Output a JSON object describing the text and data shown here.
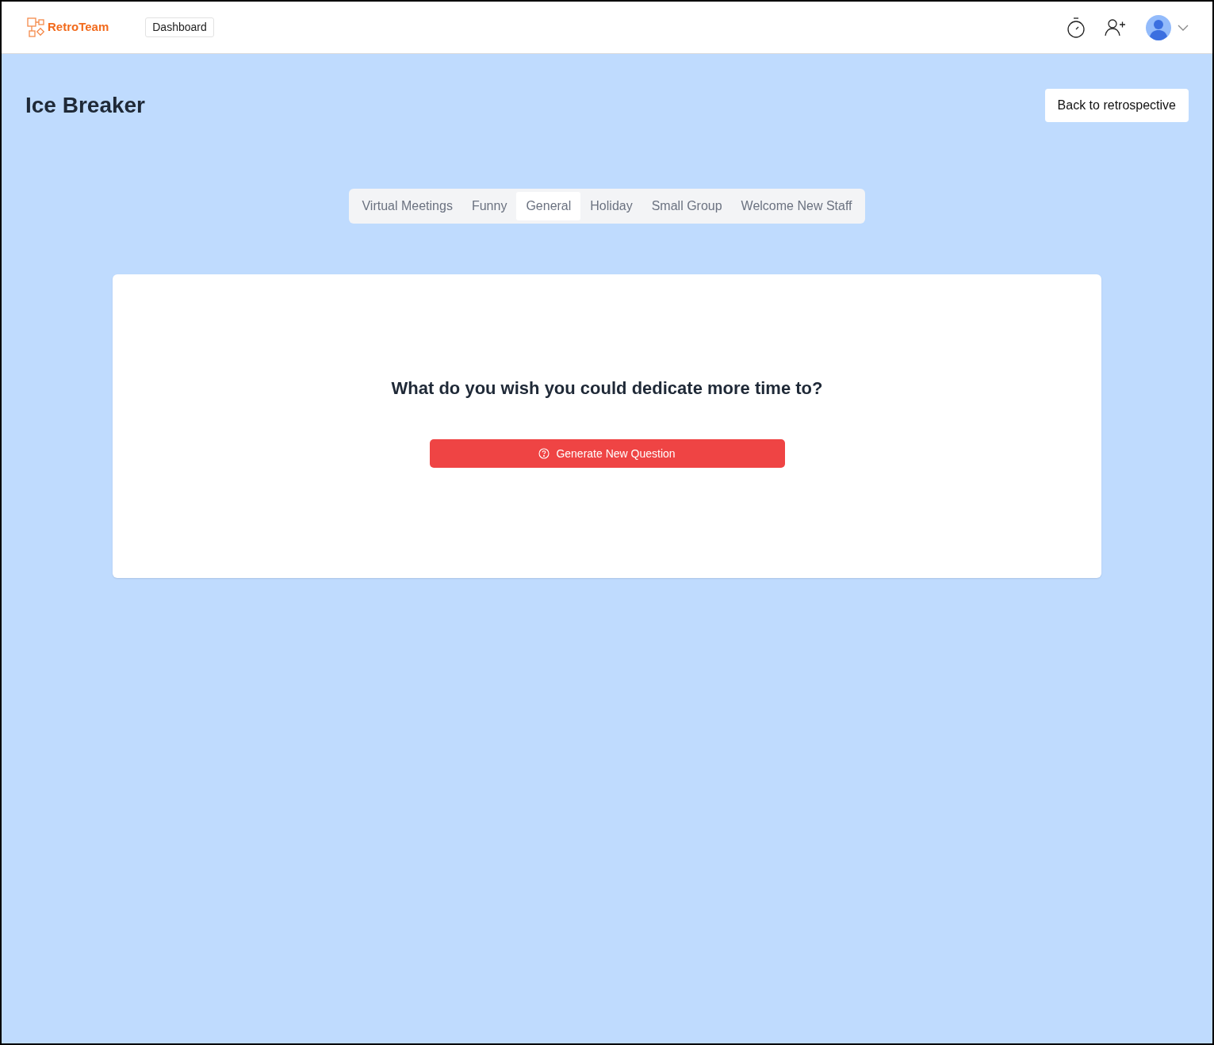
{
  "header": {
    "logo": "RetroTeam",
    "nav_link": "Dashboard"
  },
  "page": {
    "title": "Ice Breaker",
    "back_button": "Back to retrospective"
  },
  "tabs": [
    {
      "label": "Virtual Meetings",
      "selected": false
    },
    {
      "label": "Funny",
      "selected": false
    },
    {
      "label": "General",
      "selected": true
    },
    {
      "label": "Holiday",
      "selected": false
    },
    {
      "label": "Small Group",
      "selected": false
    },
    {
      "label": "Welcome New Staff",
      "selected": false
    }
  ],
  "question": {
    "text": "What do you wish you could dedicate more time to?",
    "button": "Generate New Question"
  }
}
